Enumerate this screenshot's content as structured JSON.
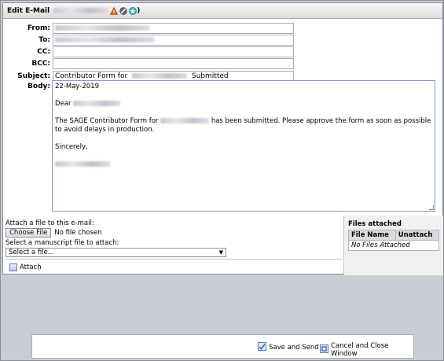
{
  "window": {
    "title": "Edit E-Mail",
    "title_suffix": ")"
  },
  "fields": {
    "from_label": "From:",
    "to_label": "To:",
    "cc_label": "CC:",
    "bcc_label": "BCC:",
    "subject_label": "Subject:",
    "body_label": "Body:",
    "subject_prefix": "Contributor Form for",
    "subject_suffix": "Submitted"
  },
  "body": {
    "date": "22-May-2019",
    "greeting": "Dear",
    "line_prefix": "The SAGE Contributor Form for",
    "line_suffix": "has been submitted. Please approve the form as soon as possible to avoid delays in production.",
    "closing": "Sincerely,"
  },
  "attachments": {
    "attach_label": "Attach a file to this e-mail:",
    "choose_file": "Choose File",
    "no_file": "No file chosen",
    "manuscript_label": "Select a manuscript file to attach:",
    "select_placeholder": "Select a file...",
    "attach_button": "Attach"
  },
  "files_attached": {
    "title": "Files attached",
    "col_file_name": "File Name",
    "col_unattach": "Unattach",
    "empty": "No Files Attached"
  },
  "footer": {
    "save_send": "Save and Send",
    "cancel_close": "Cancel and Close Window"
  },
  "colors": {
    "warning_icon": "#e06a1a",
    "star_icon": "#2fb8c8",
    "link_blue": "#2a5aa0"
  }
}
